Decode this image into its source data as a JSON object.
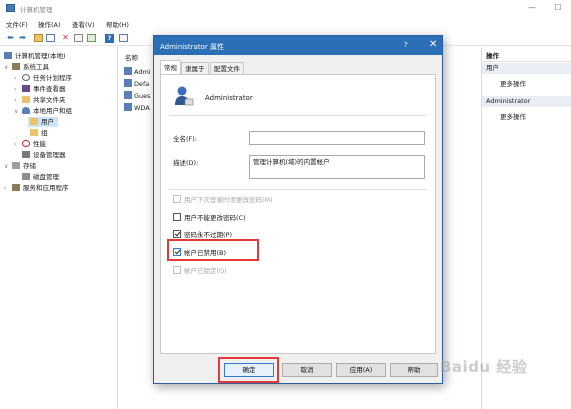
{
  "window": {
    "title": "计算机管理",
    "minimize": "—",
    "maximize": "☐"
  },
  "menu": [
    "文件(F)",
    "操作(A)",
    "查看(V)",
    "帮助(H)"
  ],
  "tree": {
    "root": "计算机管理(本地)",
    "system_tools": "系统工具",
    "task_scheduler": "任务计划程序",
    "event_viewer": "事件查看器",
    "shared_folders": "共享文件夹",
    "local_users": "本地用户和组",
    "users": "用户",
    "groups": "组",
    "performance": "性能",
    "device_manager": "设备管理器",
    "storage": "存储",
    "disk_management": "磁盘管理",
    "services": "服务和应用程序"
  },
  "list": {
    "header": "名称",
    "rows": [
      "Admi",
      "Defa",
      "Gues",
      "WDA"
    ]
  },
  "actions": {
    "header": "操作",
    "section1": "用户",
    "more1": "更多操作",
    "section2": "Administrator",
    "more2": "更多操作"
  },
  "dialog": {
    "title": "Administrator 属性",
    "help_glyph": "?",
    "close_glyph": "✕",
    "tabs": [
      "常规",
      "隶属于",
      "配置文件"
    ],
    "username": "Administrator",
    "fullname_label": "全名(F):",
    "fullname_value": "",
    "desc_label": "描述(D):",
    "desc_value": "管理计算机(域)的内置帐户",
    "checkboxes": {
      "must_change": "用户下次登录时须更改密码(M)",
      "cannot_change": "用户不能更改密码(C)",
      "never_expires": "密码永不过期(P)",
      "disabled": "帐户已禁用(B)",
      "locked": "帐户已锁定(O)"
    },
    "buttons": {
      "ok": "确定",
      "cancel": "取消",
      "apply": "应用(A)",
      "help": "帮助"
    }
  },
  "watermark": "Baidu 经验",
  "colors": {
    "dialog_title": "#2b6fb6",
    "highlight": "#e53935",
    "selection": "#cce4f7"
  }
}
